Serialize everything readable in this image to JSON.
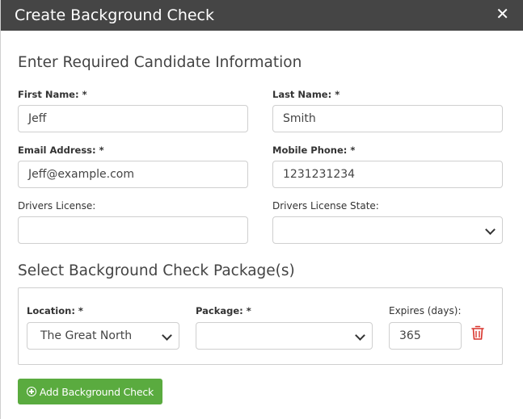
{
  "dialog": {
    "title": "Create Background Check",
    "close_glyph": "✕"
  },
  "candidate": {
    "heading": "Enter Required Candidate Information",
    "first_name": {
      "label": "First Name: *",
      "value": "Jeff"
    },
    "last_name": {
      "label": "Last Name: *",
      "value": "Smith"
    },
    "email": {
      "label": "Email Address: *",
      "value": "Jeff@example.com"
    },
    "mobile": {
      "label": "Mobile Phone: *",
      "value": "1231231234"
    },
    "license": {
      "label": "Drivers License:",
      "value": ""
    },
    "license_state": {
      "label": "Drivers License State:",
      "value": ""
    }
  },
  "packages": {
    "heading": "Select Background Check Package(s)",
    "location": {
      "label": "Location: *",
      "value": "The Great North"
    },
    "package": {
      "label": "Package: *",
      "value": ""
    },
    "expires": {
      "label": "Expires (days):",
      "value": "365"
    },
    "delete_icon": "trash-icon"
  },
  "add_button": {
    "label": "Add Background Check",
    "icon": "plus-circle-icon"
  },
  "colors": {
    "titlebar": "#454545",
    "accent_green": "#5aab3f",
    "danger": "#d9332b"
  }
}
